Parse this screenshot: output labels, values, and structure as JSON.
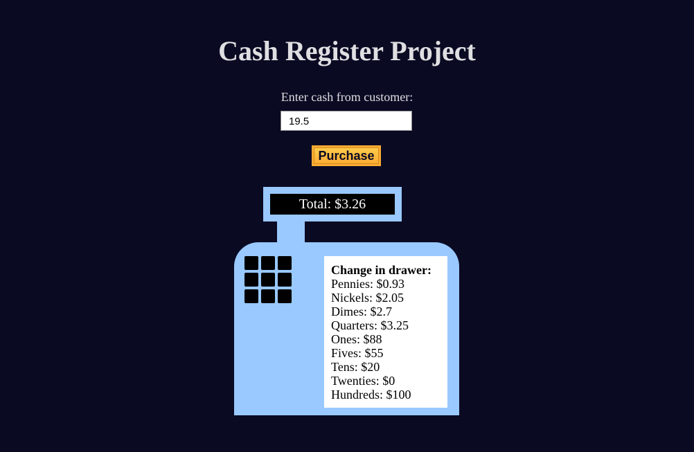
{
  "title": "Cash Register Project",
  "cash": {
    "label": "Enter cash from customer:",
    "value": "19.5",
    "placeholder": ""
  },
  "purchase_button": "Purchase",
  "register": {
    "total_text": "Total: $3.26",
    "drawer_heading": "Change in drawer:",
    "drawer": [
      {
        "name": "Pennies",
        "amount": "$0.93",
        "text": "Pennies: $0.93"
      },
      {
        "name": "Nickels",
        "amount": "$2.05",
        "text": "Nickels: $2.05"
      },
      {
        "name": "Dimes",
        "amount": "$2.7",
        "text": "Dimes: $2.7"
      },
      {
        "name": "Quarters",
        "amount": "$3.25",
        "text": "Quarters: $3.25"
      },
      {
        "name": "Ones",
        "amount": "$88",
        "text": "Ones: $88"
      },
      {
        "name": "Fives",
        "amount": "$55",
        "text": "Fives: $55"
      },
      {
        "name": "Tens",
        "amount": "$20",
        "text": "Tens: $20"
      },
      {
        "name": "Twenties",
        "amount": "$0",
        "text": "Twenties: $0"
      },
      {
        "name": "Hundreds",
        "amount": "$100",
        "text": "Hundreds: $100"
      }
    ]
  },
  "colors": {
    "background": "#0a0a23",
    "text": "#dfdfe2",
    "register": "#99c9ff",
    "button": "#feac32",
    "screen": "#000000"
  }
}
